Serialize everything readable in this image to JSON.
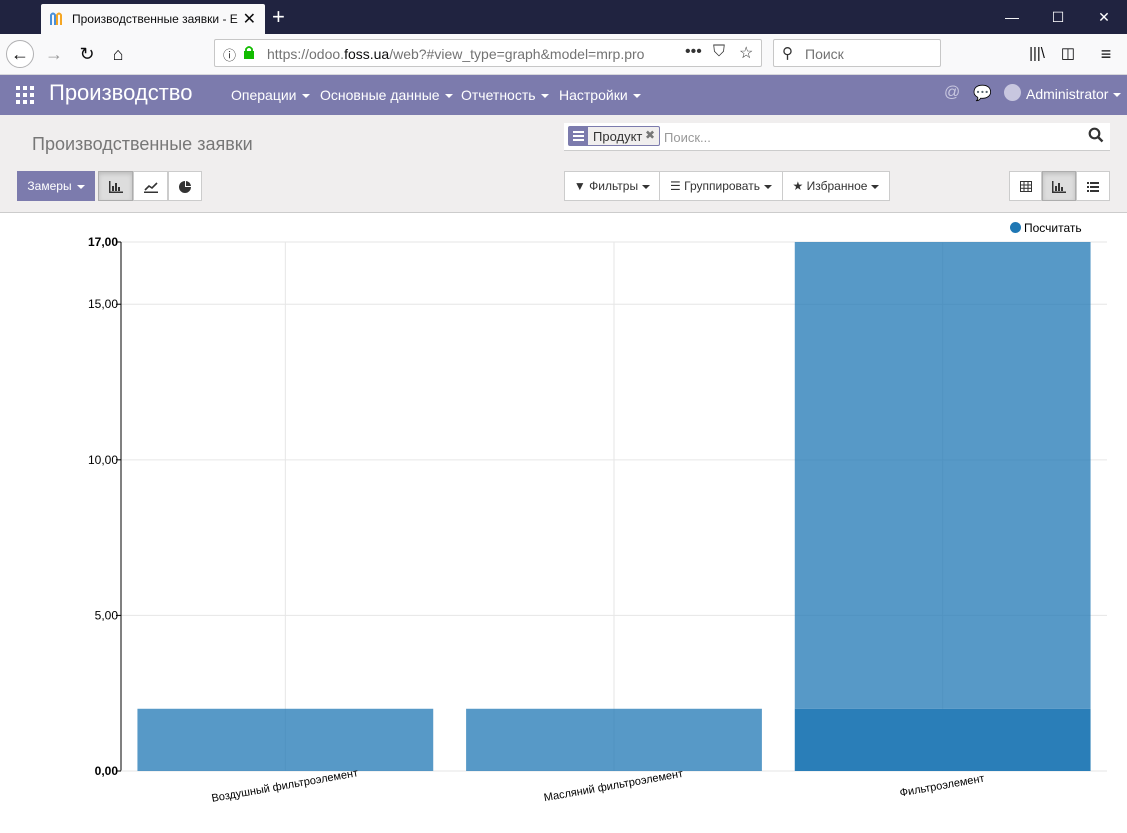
{
  "browser": {
    "tab_title": "Производственные заявки - E",
    "url_scheme": "https://odoo.",
    "url_domain": "foss.ua",
    "url_path": "/web?#view_type=graph&model=mrp.pro",
    "search_placeholder": "Поиск"
  },
  "app": {
    "brand": "Производство",
    "menus": [
      "Операции",
      "Основные данные",
      "Отчетность",
      "Настройки"
    ],
    "user": "Administrator",
    "accent": "#7c7bad"
  },
  "control_panel": {
    "breadcrumb": "Производственные заявки",
    "facet_label": "Продукт",
    "search_placeholder": "Поиск...",
    "measures_label": "Замеры",
    "filters_label": "Фильтры",
    "group_label": "Группировать",
    "favorites_label": "Избранное"
  },
  "chart_data": {
    "type": "bar",
    "categories": [
      "Воздушный фильтроэлемент",
      "Масляний фильтроэлемент",
      "Фильтроэлемент"
    ],
    "series": [
      {
        "name": "Посчитать",
        "values": [
          2,
          2,
          17
        ]
      }
    ],
    "stacked_segments_last": [
      2,
      15
    ],
    "ylim": [
      0,
      17
    ],
    "yticks": [
      "0,00",
      "5,00",
      "10,00",
      "15,00",
      "17,00"
    ],
    "ytick_values": [
      0,
      5,
      10,
      15,
      17
    ],
    "legend": "Посчитать",
    "legend_position": "top-right",
    "grid": true,
    "bar_color": "#1f77b4"
  }
}
